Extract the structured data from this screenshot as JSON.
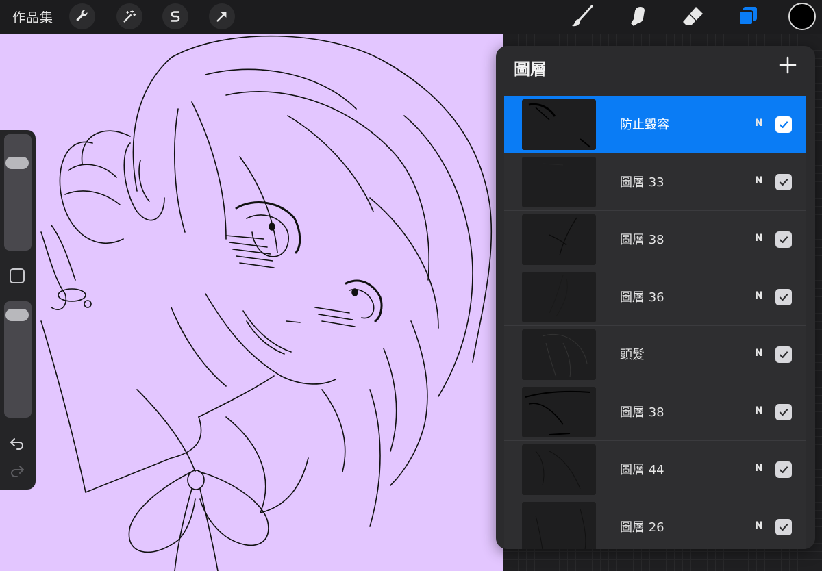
{
  "topbar": {
    "gallery_label": "作品集",
    "tools_left": [
      {
        "name": "actions",
        "icon": "wrench-icon"
      },
      {
        "name": "adjustments",
        "icon": "magic-wand-icon"
      },
      {
        "name": "selection",
        "icon": "selection-s-icon"
      },
      {
        "name": "transform",
        "icon": "arrow-cursor-icon"
      }
    ],
    "tools_right": [
      {
        "name": "brush",
        "icon": "paintbrush-icon"
      },
      {
        "name": "smudge",
        "icon": "smudge-finger-icon"
      },
      {
        "name": "eraser",
        "icon": "eraser-icon"
      },
      {
        "name": "layers",
        "icon": "layers-icon",
        "active": true
      }
    ],
    "current_color": "#000000"
  },
  "colors": {
    "canvas_bg": "#e3c6ff",
    "accent": "#0a7cf5",
    "panel_bg": "#2b2b2d"
  },
  "sidebar": {
    "brush_size_level": 0.8,
    "opacity_level": 0.95,
    "modifier_icon": "square-icon",
    "undo_icon": "undo-arrow-icon",
    "redo_icon": "redo-arrow-icon"
  },
  "layers_panel": {
    "title": "圖層",
    "add_icon": "plus-icon",
    "layers": [
      {
        "name": "防止毀容",
        "blend": "N",
        "visible": true,
        "selected": true
      },
      {
        "name": "圖層 33",
        "blend": "N",
        "visible": true,
        "selected": false
      },
      {
        "name": "圖層 38",
        "blend": "N",
        "visible": true,
        "selected": false
      },
      {
        "name": "圖層 36",
        "blend": "N",
        "visible": true,
        "selected": false
      },
      {
        "name": "頭髮",
        "blend": "N",
        "visible": true,
        "selected": false
      },
      {
        "name": "圖層 38",
        "blend": "N",
        "visible": true,
        "selected": false
      },
      {
        "name": "圖層 44",
        "blend": "N",
        "visible": true,
        "selected": false
      },
      {
        "name": "圖層 26",
        "blend": "N",
        "visible": true,
        "selected": false
      }
    ]
  }
}
